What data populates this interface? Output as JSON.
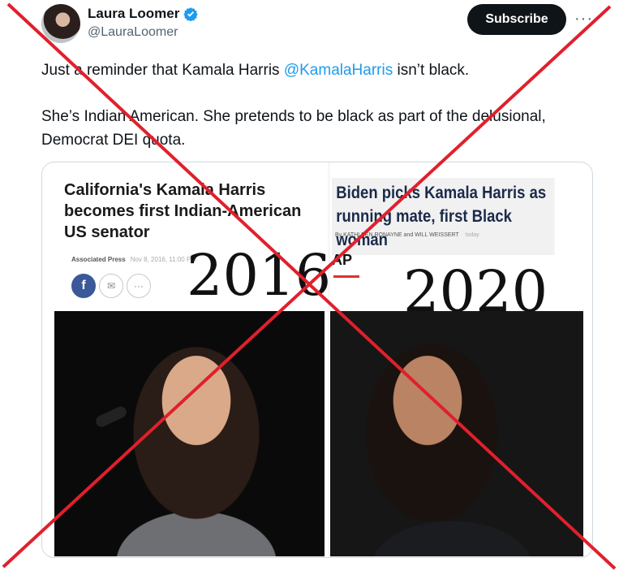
{
  "author": {
    "display_name": "Laura Loomer",
    "handle": "@LauraLoomer",
    "verified_icon": "verified-badge-icon",
    "avatar_icon": "avatar"
  },
  "actions": {
    "subscribe_label": "Subscribe",
    "more_label": "···"
  },
  "tweet": {
    "line1_before": "Just a reminder that Kamala Harris ",
    "line1_mention": "@KamalaHarris",
    "line1_after": " isn’t black.",
    "paragraph2": "She’s Indian American. She pretends to be black as part of the delusional, Democrat DEI quota."
  },
  "media": {
    "left": {
      "headline": "California's Kamala Harris becomes first Indian-American US senator",
      "byline": "Associated Press",
      "date": "Nov 8, 2016, 11:00 PM",
      "year": "2016"
    },
    "right": {
      "headline": "Biden picks Kamala Harris as running mate, first Black woman",
      "byline": "By KATHLEEN RONAYNE and WILL WEISSERT",
      "date": "today",
      "logo": "AP",
      "year": "2020"
    }
  },
  "colors": {
    "accent": "#1d9bf0",
    "x_overlay": "#e0202c",
    "button_bg": "#0f1419"
  }
}
